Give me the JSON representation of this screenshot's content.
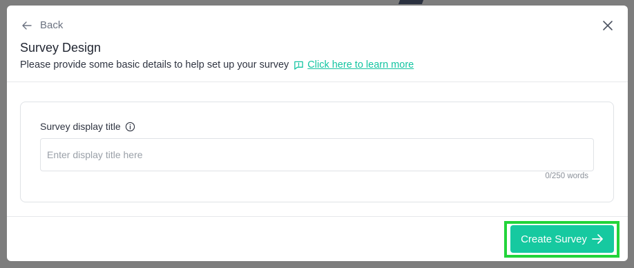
{
  "header": {
    "back_label": "Back",
    "title": "Survey Design",
    "subtitle": "Please provide some basic details to help set up your survey",
    "learn_more_label": "Click here to learn more"
  },
  "form": {
    "field_label": "Survey display title",
    "placeholder": "Enter display title here",
    "value": "",
    "word_count": "0/250 words"
  },
  "footer": {
    "create_label": "Create Survey"
  },
  "colors": {
    "accent": "#16c9a0",
    "link": "#14c4a1",
    "highlight": "#22d43a"
  },
  "icons": [
    "arrow-left-icon",
    "close-icon",
    "message-square-icon",
    "info-icon",
    "arrow-right-icon"
  ]
}
